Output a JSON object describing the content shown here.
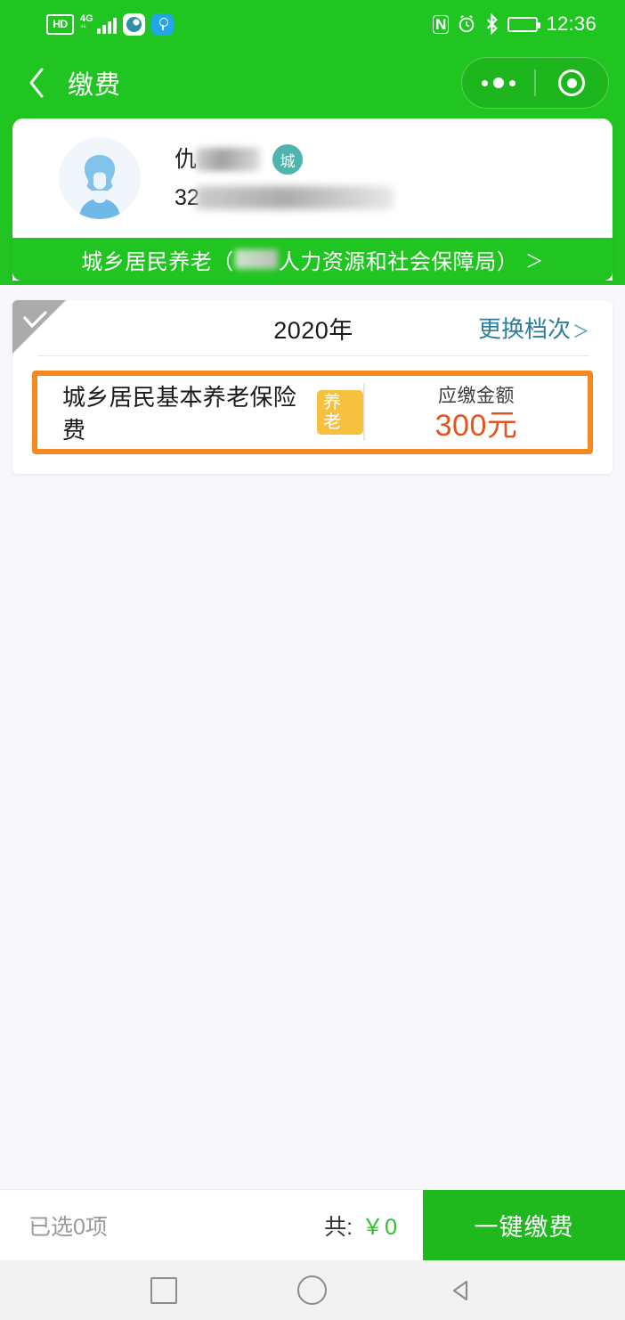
{
  "status_bar": {
    "hd_label": "HD",
    "network_label": "4G",
    "network_sub": "⁴⁵",
    "time": "12:36",
    "icons": [
      "hd-badge",
      "signal-bars",
      "app-icon-white",
      "app-icon-bulb",
      "nfc-icon",
      "alarm-icon",
      "bluetooth-icon",
      "battery-icon"
    ]
  },
  "nav": {
    "title": "缴费",
    "back_icon": "chevron-left-icon",
    "capsule": {
      "more_icon": "more-dots-icon",
      "target_icon": "target-circle-icon"
    }
  },
  "user_card": {
    "avatar_icon": "user-avatar-icon",
    "name_prefix": "仇",
    "badge_label": "城",
    "id_prefix": "32",
    "org_text_before": "城乡居民养老（",
    "org_text_after": "人力资源和社会保障局）",
    "org_arrow": "＞"
  },
  "pay_card": {
    "corner_icon": "check-icon",
    "year": "2020年",
    "change_level_label": "更换档次",
    "change_level_arrow": "＞",
    "item": {
      "name": "城乡居民基本养老保险费",
      "tag": "养老",
      "amount_label": "应缴金额",
      "amount_value": "300元"
    }
  },
  "bottom_bar": {
    "selected_text": "已选0项",
    "total_label": "共:",
    "total_amount": "￥0",
    "pay_button": "一键缴费"
  },
  "android_nav": {
    "recents_icon": "square-icon",
    "home_icon": "circle-icon",
    "back_icon": "triangle-left-icon"
  },
  "colors": {
    "brand_green": "#21C521",
    "button_green": "#1FB91F",
    "amount_orange": "#E8521E",
    "item_border_orange": "#F5881F",
    "tag_yellow": "#F7C140",
    "link_teal": "#2E7E9E",
    "badge_teal": "#4FB3AE"
  }
}
